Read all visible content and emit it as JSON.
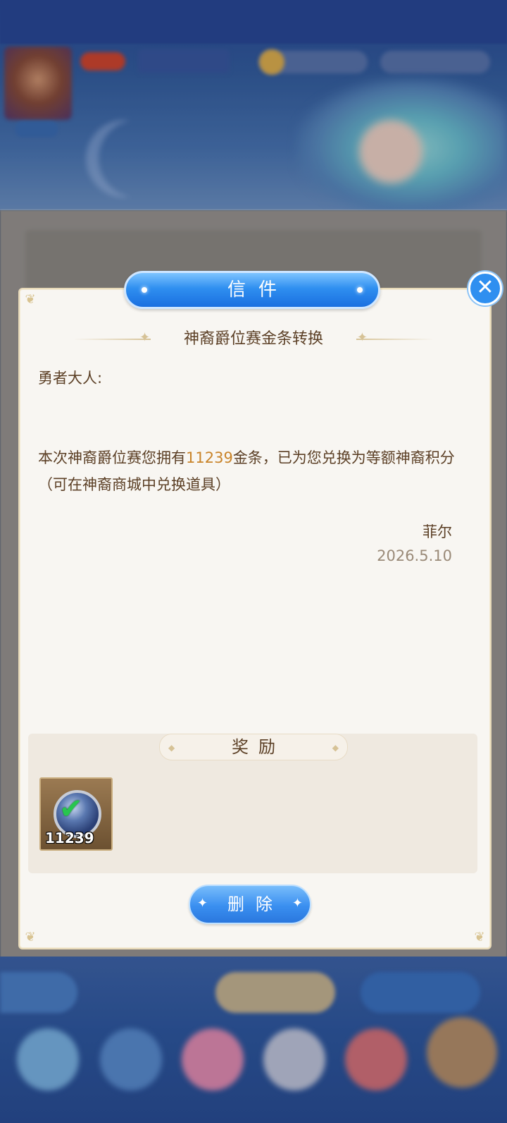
{
  "dialog": {
    "header_title": "信件",
    "subject": "神裔爵位赛金条转换",
    "greeting": "勇者大人:",
    "body_pre": "本次神裔爵位赛您拥有",
    "body_highlight": "11239",
    "body_post": "金条，已为您兑换为等额神裔积分（可在神裔商城中兑换道具）",
    "signer": "菲尔",
    "date": "2026.5.10",
    "reward_title": "奖励",
    "reward_items": [
      {
        "icon": "divine-points-coin-icon",
        "count": "11239"
      }
    ],
    "delete_label": "删除"
  },
  "colors": {
    "accent_blue": "#2f8ff0",
    "text_brown": "#5b3f25",
    "highlight_gold": "#c9842a",
    "paper": "#f8f6f2"
  }
}
